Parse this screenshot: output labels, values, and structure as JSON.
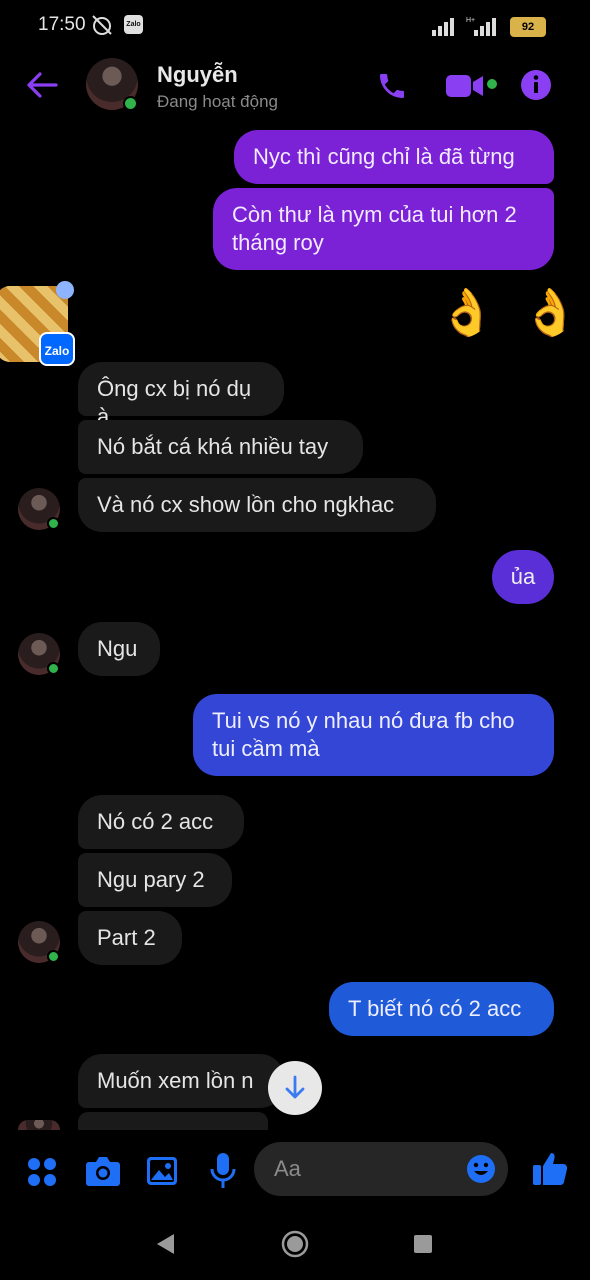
{
  "status_bar": {
    "time": "17:50",
    "zalo_label": "Zalo",
    "battery": "92"
  },
  "header": {
    "name": "Nguyễn",
    "status": "Đang hoạt động"
  },
  "messages": [
    {
      "text": "Nyc thì cũng chỉ là đã từng"
    },
    {
      "text": "Còn thư là nym của tui hơn 2 tháng roy"
    },
    {
      "text": "👌 👌"
    },
    {
      "text": "Ông cx bị nó dụ à"
    },
    {
      "text": "Nó bắt cá khá nhiều tay"
    },
    {
      "text": "Và nó cx show lồn cho ngkhac"
    },
    {
      "text": "ủa"
    },
    {
      "text": "Ngu"
    },
    {
      "text": "Tui vs nó y nhau nó đưa fb cho tui cầm mà"
    },
    {
      "text": "Nó có 2 acc"
    },
    {
      "text": "Ngu pary 2"
    },
    {
      "text": "Part 2"
    },
    {
      "text": "T biết nó có 2 acc"
    },
    {
      "text": "Muốn xem lồn n"
    }
  ],
  "bubble_app": {
    "label": "Zalo"
  },
  "composer": {
    "placeholder": "Aa"
  },
  "colors": {
    "accent": "#8a3ff2",
    "online": "#2fb34a"
  }
}
